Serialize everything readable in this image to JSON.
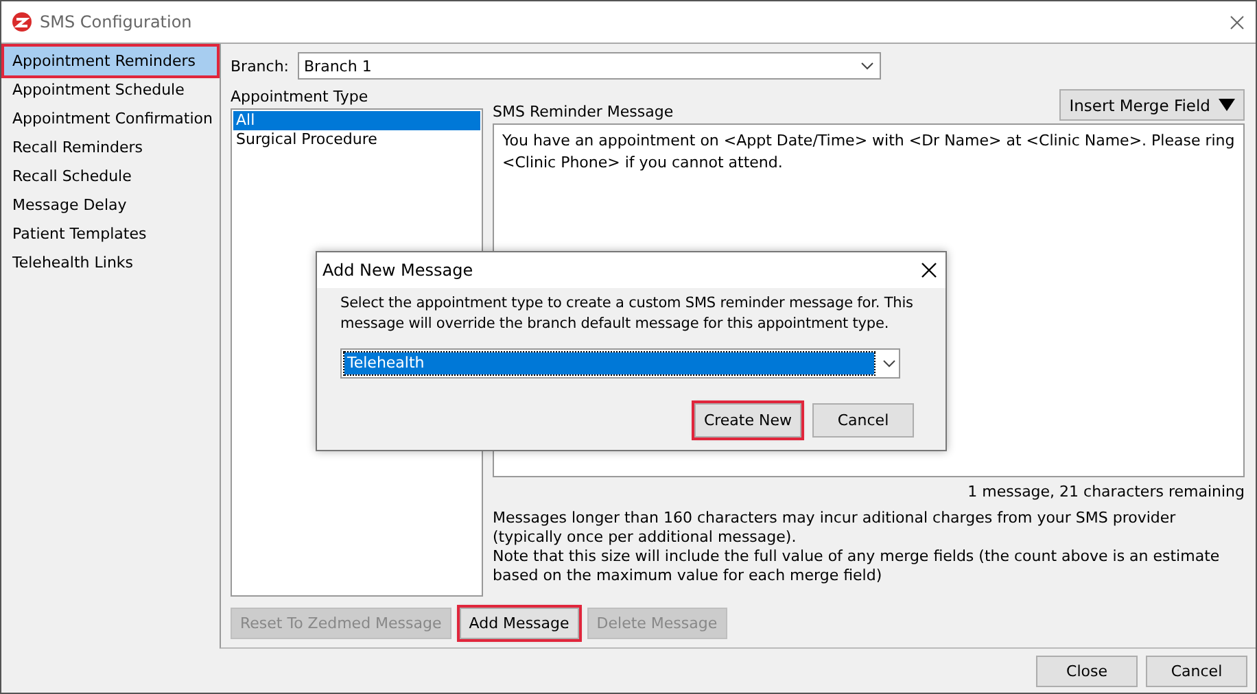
{
  "window": {
    "title": "SMS Configuration"
  },
  "sidebar": {
    "items": [
      {
        "label": "Appointment Reminders",
        "selected": true,
        "highlighted": true
      },
      {
        "label": "Appointment Schedule",
        "selected": false,
        "highlighted": false
      },
      {
        "label": "Appointment Confirmation",
        "selected": false,
        "highlighted": false
      },
      {
        "label": "Recall Reminders",
        "selected": false,
        "highlighted": false
      },
      {
        "label": "Recall Schedule",
        "selected": false,
        "highlighted": false
      },
      {
        "label": "Message Delay",
        "selected": false,
        "highlighted": false
      },
      {
        "label": "Patient Templates",
        "selected": false,
        "highlighted": false
      },
      {
        "label": "Telehealth Links",
        "selected": false,
        "highlighted": false
      }
    ]
  },
  "branch": {
    "label": "Branch:",
    "value": "Branch 1"
  },
  "appointment_type": {
    "label": "Appointment Type",
    "items": [
      {
        "label": "All",
        "selected": true
      },
      {
        "label": "Surgical Procedure",
        "selected": false
      }
    ]
  },
  "message": {
    "label": "SMS Reminder Message",
    "insert_button": "Insert Merge Field",
    "value": "You have an appointment on <Appt Date/Time> with <Dr Name> at <Clinic Name>. Please ring <Clinic Phone> if you cannot attend.",
    "counter": "1 message, 21 characters remaining",
    "notes": [
      "Messages longer than 160 characters may incur aditional charges from your SMS provider (typically once per additional message).",
      "Note that this size will include the full value of any merge fields (the count above is an estimate based on the maximum value for each merge field)"
    ]
  },
  "actions": [
    {
      "label": "Reset To Zedmed Message",
      "disabled": true,
      "highlighted": false
    },
    {
      "label": "Add Message",
      "disabled": false,
      "highlighted": true
    },
    {
      "label": "Delete Message",
      "disabled": true,
      "highlighted": false
    }
  ],
  "footer_buttons": [
    "Close",
    "Cancel"
  ],
  "dialog": {
    "title": "Add New Message",
    "text": "Select the appointment type to create a custom SMS reminder message for. This message will override the branch default message for this appointment type.",
    "select_value": "Telehealth",
    "buttons": [
      {
        "label": "Create New",
        "highlighted": true
      },
      {
        "label": "Cancel",
        "highlighted": false
      }
    ]
  }
}
